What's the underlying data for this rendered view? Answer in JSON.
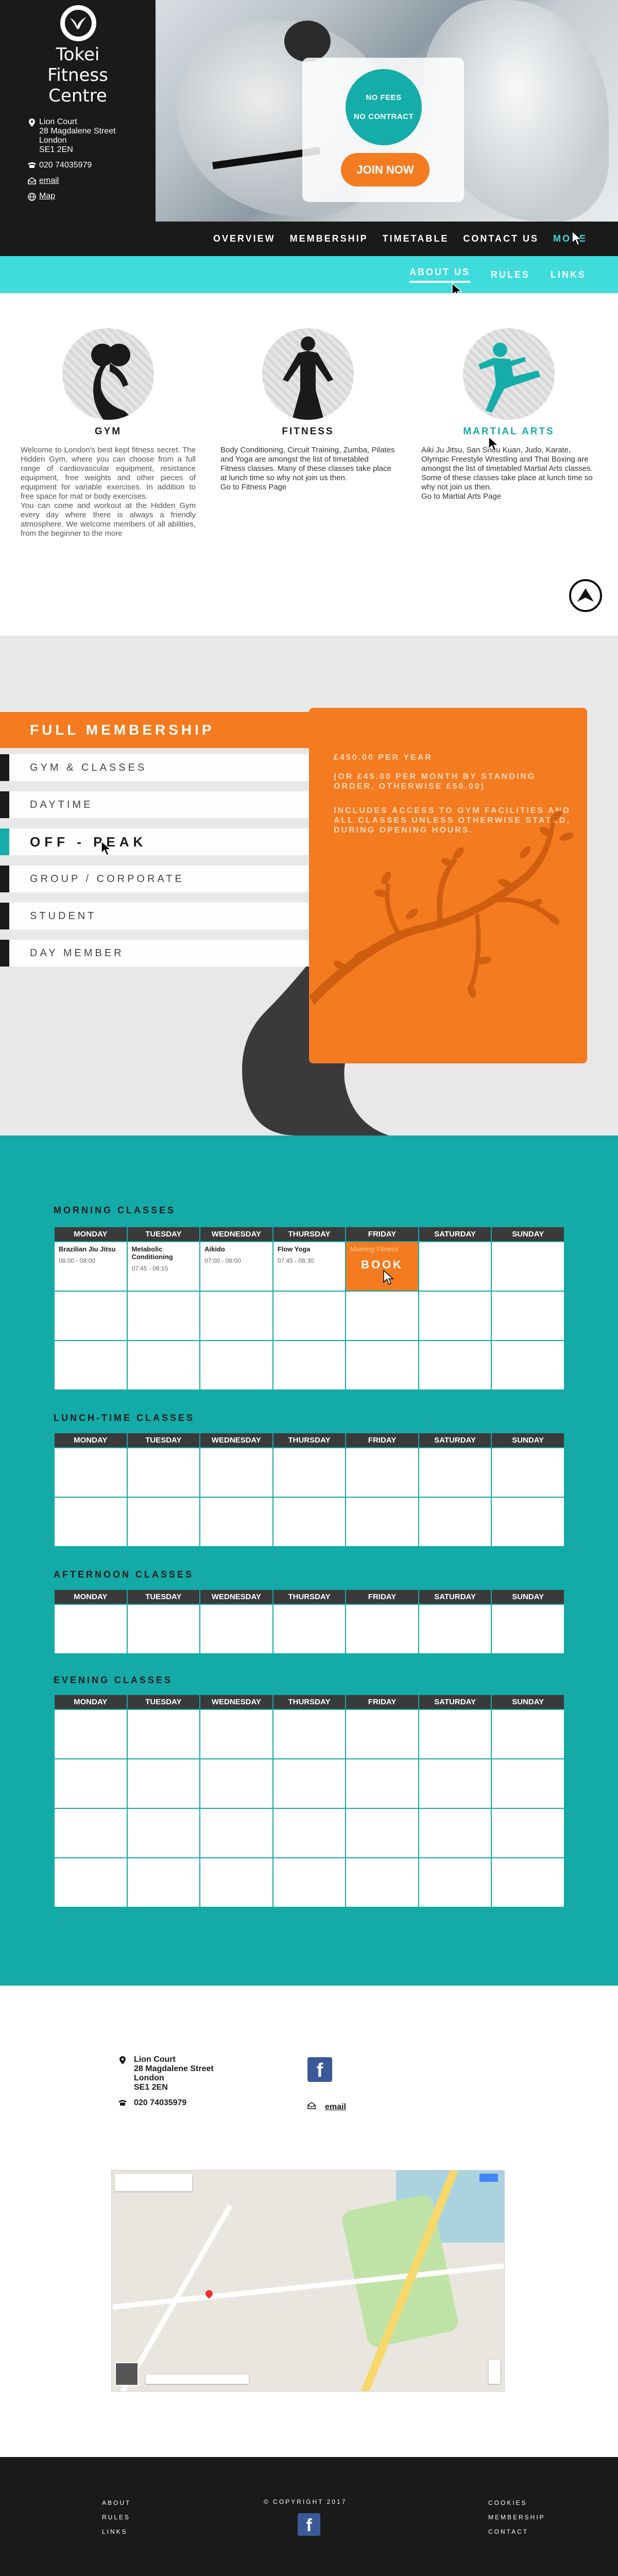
{
  "brand": {
    "name_line1": "Tokei",
    "name_line2": "Fitness",
    "name_line3": "Centre"
  },
  "contact_side": {
    "address": [
      "Lion Court",
      "28 Magdalene Street",
      "London",
      "SE1 2EN"
    ],
    "phone": "020 74035979",
    "email_label": "email",
    "map_label": "Map"
  },
  "promo": {
    "line1": "NO FEES",
    "line2": "NO CONTRACT",
    "join_label": "JOIN NOW"
  },
  "nav": {
    "overview": "OVERVIEW",
    "membership": "MEMBERSHIP",
    "timetable": "TIMETABLE",
    "contact": "CONTACT US",
    "more": "MORE"
  },
  "subnav": {
    "about": "ABOUT US",
    "rules": "RULES",
    "links": "LINKS"
  },
  "features": {
    "gym": {
      "title": "GYM",
      "text": "Welcome to London's best kept fitness secret. The Hidden Gym, where you can choose from a full range of cardiovascular equipment, resistance equipment, free weights and other pieces of equipment for variable exercises. In addition to free space for mat or body exercises.",
      "text2": "You can come and workout at the Hidden Gym every day where there is always a friendly atmosphere. We welcome members of all abilities, from the beginner to the more"
    },
    "fitness": {
      "title": "FITNESS",
      "text": "Body Conditioning, Circuit Training, Zumba, Pilates and Yoga are amongst the list of timetabled Fitness classes. Many of these classes take place at lunch time so why not join us then.",
      "link": "Go to Fitness Page"
    },
    "martial": {
      "title": "MARTIAL ARTS",
      "text": "Aiki Ju Jitsu, San Shou Kuan, Judo, Karate, Olympic Freestyle Wrestling and Thai Boxing are amongst the list of timetabled Martial Arts classes. Some of these classes take place at lunch time so why not join us then.",
      "link": "Go to Martial Arts Page"
    }
  },
  "membership": {
    "title": "FULL MEMBERSHIP",
    "items": [
      "GYM & CLASSES",
      "DAYTIME",
      "OFF - PEAK",
      "GROUP / CORPORATE",
      "STUDENT",
      "DAY MEMBER"
    ],
    "selected_index": 2,
    "price": "£450.00 PER YEAR",
    "monthly": "(OR £45.00 PER MONTH BY STANDING ORDER, OTHERWISE £50.00)",
    "includes": "INCLUDES ACCESS TO GYM FACILITIES AND ALL CLASSES UNLESS OTHERWISE STATED, DURING OPENING HOURS."
  },
  "timetable": {
    "days": [
      "MONDAY",
      "TUESDAY",
      "WEDNESDAY",
      "THURSDAY",
      "FRIDAY",
      "SATURDAY",
      "SUNDAY"
    ],
    "morning_title": "MORNING CLASSES",
    "lunch_title": "LUNCH-TIME CLASSES",
    "afternoon_title": "AFTERNOON CLASSES",
    "evening_title": "EVENING CLASSES",
    "morning": [
      {
        "name": "Brazilian Jiu Jitsu",
        "time": "08:00 - 08:00"
      },
      {
        "name": "Metabolic Conditioning",
        "time": "07:45 - 08:15"
      },
      {
        "name": "Aikido",
        "time": "07:00 - 08:00"
      },
      {
        "name": "Flow Yoga",
        "time": "07:45 - 08:30"
      },
      {
        "name": "Morning Fitness",
        "time": ""
      }
    ],
    "book_label": "BOOK"
  },
  "contact": {
    "address": [
      "Lion Court",
      "28 Magdalene Street",
      "London",
      "SE1 2EN"
    ],
    "phone": "020 74035979",
    "email_label": "email"
  },
  "footer": {
    "left": [
      "ABOUT",
      "RULES",
      "LINKS"
    ],
    "copyright": "© COPYRIGHT 2017",
    "right": [
      "COOKIES",
      "MEMBERSHIP",
      "CONTACT"
    ]
  },
  "colors": {
    "teal": "#15ada9",
    "light_teal": "#3fdcdc",
    "orange": "#f47b20",
    "dark": "#1a1a1a"
  }
}
